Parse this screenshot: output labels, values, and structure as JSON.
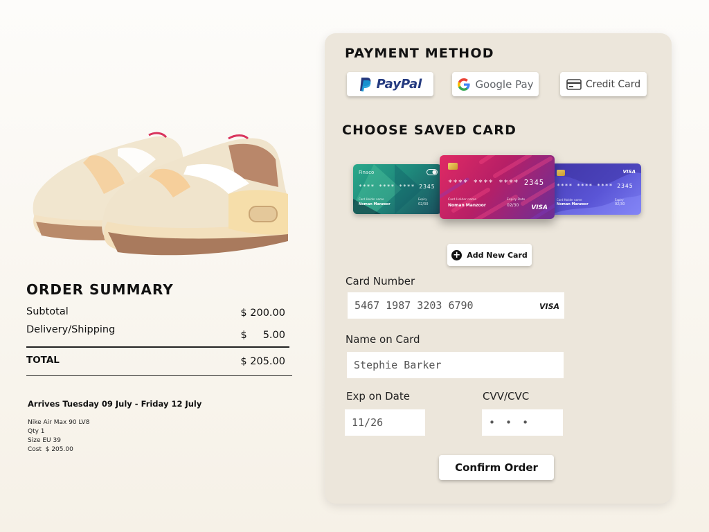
{
  "order_summary": {
    "title": "ORDER SUMMARY",
    "subtotal_label": "Subtotal",
    "subtotal_value": "$ 200.00",
    "shipping_label": "Delivery/Shipping",
    "shipping_value": "$     5.00",
    "total_label": "TOTAL",
    "total_value": "$ 205.00"
  },
  "arrival": "Arrives Tuesday 09 July - Friday 12 July",
  "product_details": {
    "name": "Nike Air Max 90 LV8",
    "qty": "Qty 1",
    "size": "Size EU 39",
    "cost": "Cost  $ 205.00"
  },
  "payment": {
    "title": "PAYMENT METHOD",
    "methods": {
      "paypal": "PayPal",
      "google": "Google Pay",
      "credit": "Credit Card"
    }
  },
  "saved_cards": {
    "title": "CHOOSE SAVED CARD",
    "cards": [
      {
        "brand": "Finaco",
        "number": "**** **** **** 2345",
        "holder": "Noman Manzoor",
        "holder_label": "Card Holder name",
        "expiry_label": "Expiry",
        "expiry": "02/30"
      },
      {
        "brand": "VISA",
        "number": "**** **** **** 2345",
        "holder": "Noman Manzoor",
        "holder_label": "Card Holder name",
        "expiry_label": "Expiry Date",
        "expiry": "02/30"
      },
      {
        "brand": "VISA",
        "number": "**** **** **** 2345",
        "holder": "Noman Manzoor",
        "holder_label": "Card Holder name",
        "expiry_label": "Expiry",
        "expiry": "02/30"
      }
    ],
    "add_label": "Add New Card"
  },
  "form": {
    "card_number_label": "Card Number",
    "card_number_value": "5467 1987 3203 6790",
    "card_brand": "VISA",
    "name_label": "Name on Card",
    "name_value": "Stephie Barker",
    "exp_label": "Exp on Date",
    "exp_value": "11/26",
    "cvv_label": "CVV/CVC",
    "cvv_value": "• • •"
  },
  "confirm_label": "Confirm Order",
  "colors": {
    "panel_bg": "#ece6db",
    "paypal_dark": "#253b80",
    "paypal_light": "#179bd7"
  }
}
